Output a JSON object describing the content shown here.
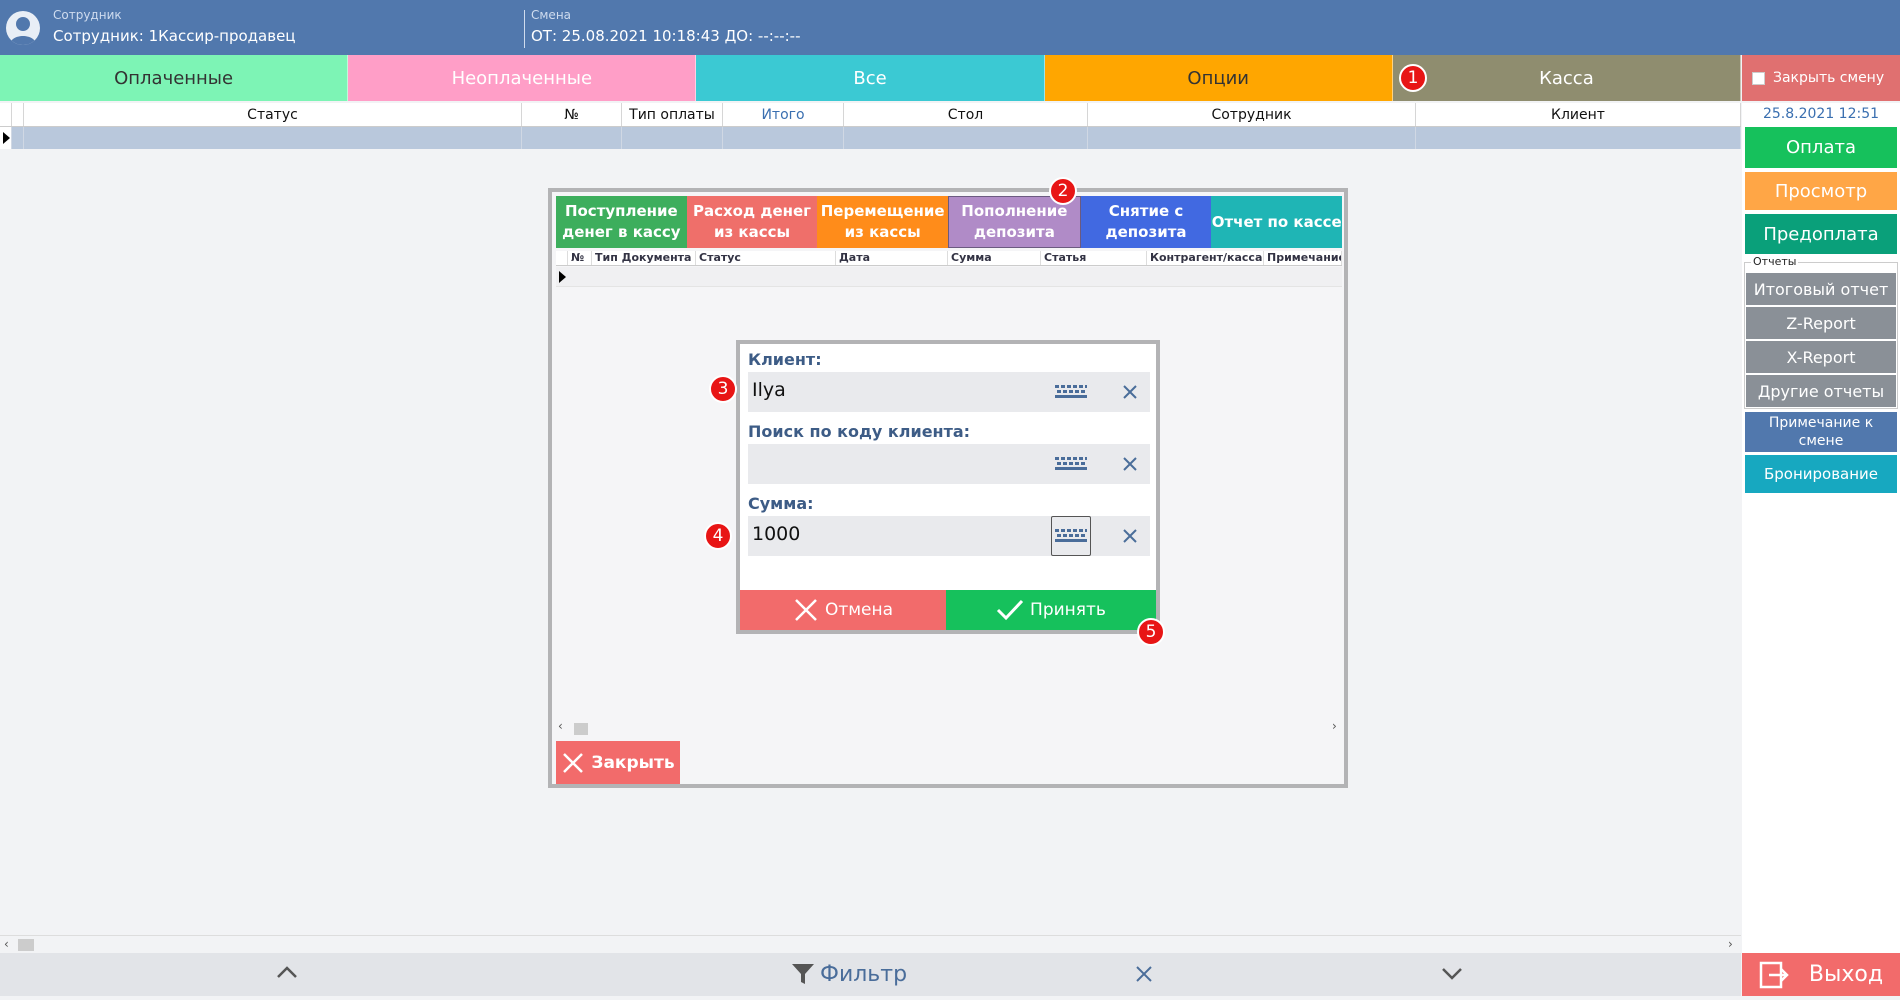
{
  "header": {
    "employee_small": "Сотрудник",
    "employee_main": "Сотрудник: 1Кассир-продавец",
    "shift_small": "Смена",
    "shift_main": "ОТ: 25.08.2021 10:18:43 ДО: --:--:--"
  },
  "tabs": [
    {
      "label": "Оплаченные",
      "color": "#7df4b5",
      "text": "#333333"
    },
    {
      "label": "Неоплаченные",
      "color": "#ff9ec7",
      "text": "#ffffff"
    },
    {
      "label": "Все",
      "color": "#3bc9d3",
      "text": "#ffffff"
    },
    {
      "label": "Опции",
      "color": "#ffa600",
      "text": "#333333"
    },
    {
      "label": "Касса",
      "color": "#8f8d6f",
      "text": "#ffffff"
    }
  ],
  "close_shift": {
    "label": "Закрыть смену"
  },
  "grid": {
    "columns": [
      "Статус",
      "№",
      "Тип оплаты",
      "Итого",
      "Стол",
      "Сотрудник",
      "Клиент"
    ]
  },
  "right_panel": {
    "date": "25.8.2021 12:51",
    "pay": "Оплата",
    "view": "Просмотр",
    "prepay": "Предоплата",
    "reports_title": "Отчеты",
    "reports": [
      "Итоговый отчет",
      "Z-Report",
      "X-Report",
      "Другие отчеты"
    ],
    "shift_note": "Примечание к смене",
    "booking": "Бронирование",
    "colors": {
      "pay": "#16c15c",
      "view": "#ffa646",
      "prepay": "#0aa07a",
      "note": "#5178ad",
      "booking": "#17a8c0"
    }
  },
  "bottom": {
    "filter": "Фильтр",
    "exit": "Выход"
  },
  "cash_dialog": {
    "operations": [
      {
        "label": "Поступление денег в кассу",
        "color": "#3dae5d"
      },
      {
        "label": "Расход денег из кассы",
        "color": "#ef6f6a"
      },
      {
        "label": "Перемещение из кассы",
        "color": "#ff8c1a"
      },
      {
        "label": "Пополнение депозита",
        "color": "#b08bc7"
      },
      {
        "label": "Снятие с депозита",
        "color": "#4169e1"
      },
      {
        "label": "Отчет по кассе",
        "color": "#1fb5b5"
      }
    ],
    "columns": [
      "№",
      "Тип Документа",
      "Статус",
      "Дата",
      "Сумма",
      "Статья",
      "Контрагент/касса",
      "Примечание"
    ],
    "close": "Закрыть"
  },
  "deposit_form": {
    "client_label": "Клиент:",
    "client_value": "Ilya",
    "search_label": "Поиск по коду клиента:",
    "search_value": "",
    "sum_label": "Сумма:",
    "sum_value": "1000",
    "cancel": "Отмена",
    "accept": "Принять"
  },
  "markers": [
    "1",
    "2",
    "3",
    "4",
    "5"
  ]
}
